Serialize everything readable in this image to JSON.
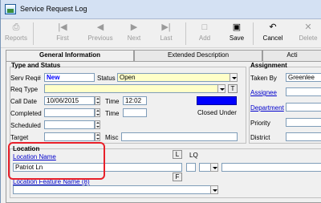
{
  "window": {
    "title": "Service Request Log"
  },
  "toolbar": {
    "reports": "Reports",
    "first": "First",
    "previous": "Previous",
    "next": "Next",
    "last": "Last",
    "add": "Add",
    "save": "Save",
    "cancel": "Cancel",
    "delete": "Delete"
  },
  "tabs": {
    "general": "General Information",
    "extended": "Extended Description",
    "actions": "Acti"
  },
  "type_status": {
    "title": "Type and Status",
    "serv_label": "Serv Req#",
    "serv_value": "New",
    "status_label": "Status",
    "status_value": "Open",
    "req_type_label": "Req Type",
    "req_type_value": "",
    "t_button": "T",
    "call_date_label": "Call Date",
    "call_date_value": "10/06/2015",
    "time_label": "Time",
    "call_time_value": "12:02",
    "completed_label": "Completed",
    "completed_value": "",
    "completed_time_label": "Time",
    "completed_time_value": "",
    "closed_under_label": "Closed Under",
    "scheduled_label": "Scheduled",
    "scheduled_value": "",
    "target_label": "Target",
    "target_value": "",
    "misc_label": "Misc",
    "misc_value": ""
  },
  "assignment": {
    "title": "Assignment",
    "taken_by_label": "Taken By",
    "taken_by_value": "Greenlee",
    "assignee_label": "Assignee",
    "department_label": "Department",
    "priority_label": "Priority",
    "district_label": "District"
  },
  "location": {
    "title": "Location",
    "name_label": "Location Name",
    "name_value": "Patriot Ln",
    "l_button": "L",
    "lq_label": "LQ",
    "f_button": "F",
    "feature_label": "Location Feature Name (8)"
  },
  "colors": {
    "highlight": "#e8202a",
    "link": "#0000cc",
    "required": "#ffffc8"
  }
}
